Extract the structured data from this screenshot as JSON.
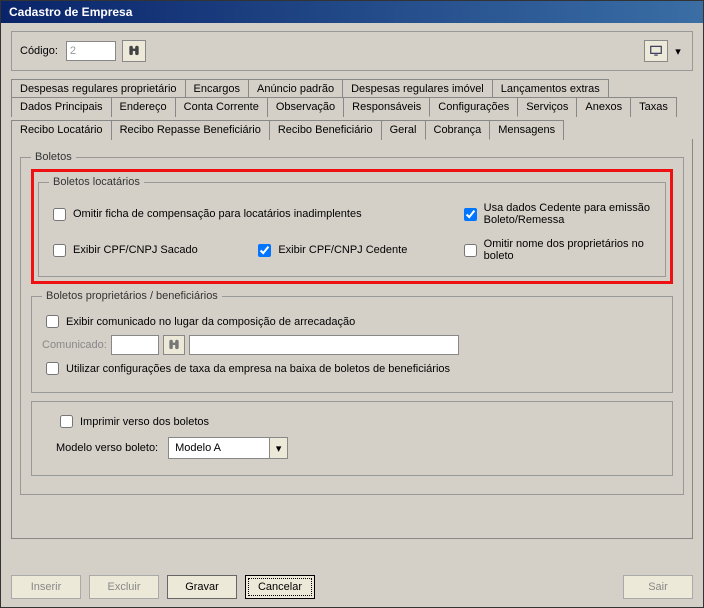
{
  "window": {
    "title": "Cadastro de Empresa"
  },
  "toprow": {
    "code_label": "Código:",
    "code_value": "2"
  },
  "tabs_row1": [
    "Despesas regulares proprietário",
    "Encargos",
    "Anúncio padrão",
    "Despesas regulares imóvel",
    "Lançamentos extras"
  ],
  "tabs_row2": [
    "Dados Principais",
    "Endereço",
    "Conta Corrente",
    "Observação",
    "Responsáveis",
    "Configurações",
    "Serviços",
    "Anexos",
    "Taxas"
  ],
  "tabs_row2_active": "Configurações",
  "tabs_row3": [
    "Recibo Locatário",
    "Recibo Repasse Beneficiário",
    "Recibo Beneficiário",
    "Geral",
    "Cobrança",
    "Mensagens"
  ],
  "tabs_row3_active": "Cobrança",
  "boletos": {
    "legend": "Boletos",
    "locatarios": {
      "legend": "Boletos locatários",
      "chk1": {
        "label": "Omitir ficha de compensação para locatários inadimplentes",
        "checked": false
      },
      "chk2": {
        "label": "Usa dados Cedente para emissão Boleto/Remessa",
        "checked": true
      },
      "chk3": {
        "label": "Exibir CPF/CNPJ Sacado",
        "checked": false
      },
      "chk4": {
        "label": "Exibir CPF/CNPJ Cedente",
        "checked": true
      },
      "chk5": {
        "label": "Omitir nome dos proprietários no boleto",
        "checked": false
      }
    },
    "proprietarios": {
      "legend": "Boletos proprietários / beneficiários",
      "chk1": {
        "label": "Exibir comunicado no lugar da composição de arrecadação",
        "checked": false
      },
      "comunicado_label": "Comunicado:",
      "chk2": {
        "label": "Utilizar configurações de taxa da empresa na baixa de boletos de beneficiários",
        "checked": false
      }
    },
    "verso": {
      "chk": {
        "label": "Imprimir verso dos boletos",
        "checked": false
      },
      "modelo_label": "Modelo verso boleto:",
      "modelo_value": "Modelo A"
    }
  },
  "buttons": {
    "inserir": "Inserir",
    "excluir": "Excluir",
    "gravar": "Gravar",
    "cancelar": "Cancelar",
    "sair": "Sair"
  }
}
